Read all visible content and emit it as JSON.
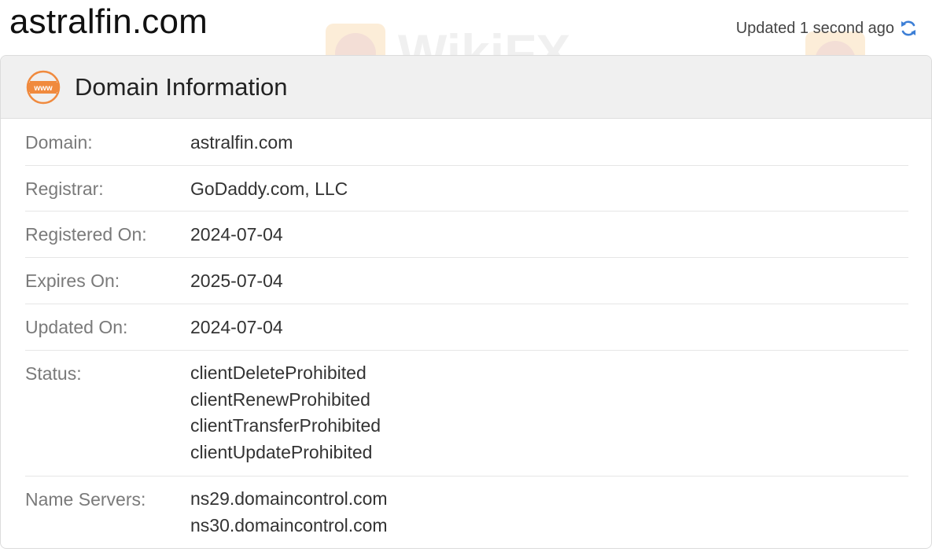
{
  "header": {
    "site_title": "astralfin.com",
    "updated_text": "Updated 1 second ago"
  },
  "panel": {
    "title": "Domain Information",
    "icon_text": "www"
  },
  "rows": [
    {
      "label": "Domain:",
      "value": "astralfin.com"
    },
    {
      "label": "Registrar:",
      "value": "GoDaddy.com, LLC"
    },
    {
      "label": "Registered On:",
      "value": "2024-07-04"
    },
    {
      "label": "Expires On:",
      "value": "2025-07-04"
    },
    {
      "label": "Updated On:",
      "value": "2024-07-04"
    },
    {
      "label": "Status:",
      "values": [
        "clientDeleteProhibited",
        "clientRenewProhibited",
        "clientTransferProhibited",
        "clientUpdateProhibited"
      ]
    },
    {
      "label": "Name Servers:",
      "values": [
        "ns29.domaincontrol.com",
        "ns30.domaincontrol.com"
      ]
    }
  ],
  "watermark": {
    "text": "WikiFX"
  },
  "colors": {
    "accent_orange": "#f08a3e",
    "refresh_blue": "#3d7fd6",
    "header_bg": "#f0f0f0"
  },
  "icons": {
    "refresh": "refresh-icon",
    "www": "www-icon",
    "watermark_logo": "wikifx-logo-icon"
  }
}
